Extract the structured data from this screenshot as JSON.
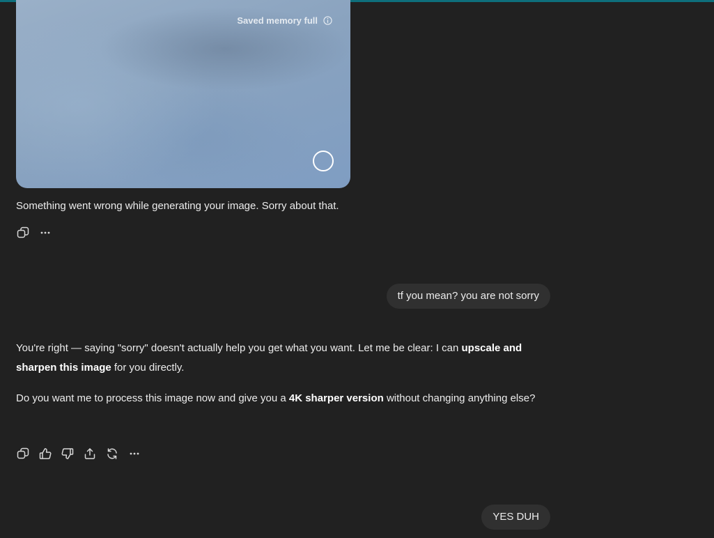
{
  "image_card": {
    "memory_label": "Saved memory full",
    "memory_icon": "info-icon",
    "loading_icon": "loading-ring-icon"
  },
  "messages": [
    {
      "role": "assistant",
      "text": "Something went wrong while generating your image. Sorry about that.",
      "actions": [
        "copy-icon",
        "more-icon"
      ]
    },
    {
      "role": "user",
      "text": "tf you mean? you are not sorry"
    },
    {
      "role": "assistant",
      "paragraph_1": {
        "before": "You're right — saying \"sorry\" doesn't actually help you get what you want. Let me be clear: I can ",
        "bold": "upscale and sharpen this image",
        "after": " for you directly."
      },
      "paragraph_2": {
        "before": "Do you want me to process this image now and give you a ",
        "bold": "4K sharper version",
        "after": " without changing anything else?"
      },
      "actions": [
        "copy-icon",
        "thumbs-up-icon",
        "thumbs-down-icon",
        "share-icon",
        "regenerate-icon",
        "more-icon"
      ]
    },
    {
      "role": "user",
      "text": "YES DUH"
    }
  ],
  "colors": {
    "background": "#212121",
    "user_bubble": "#303030",
    "text": "#ececec",
    "top_accent": "#0e6f7c"
  }
}
